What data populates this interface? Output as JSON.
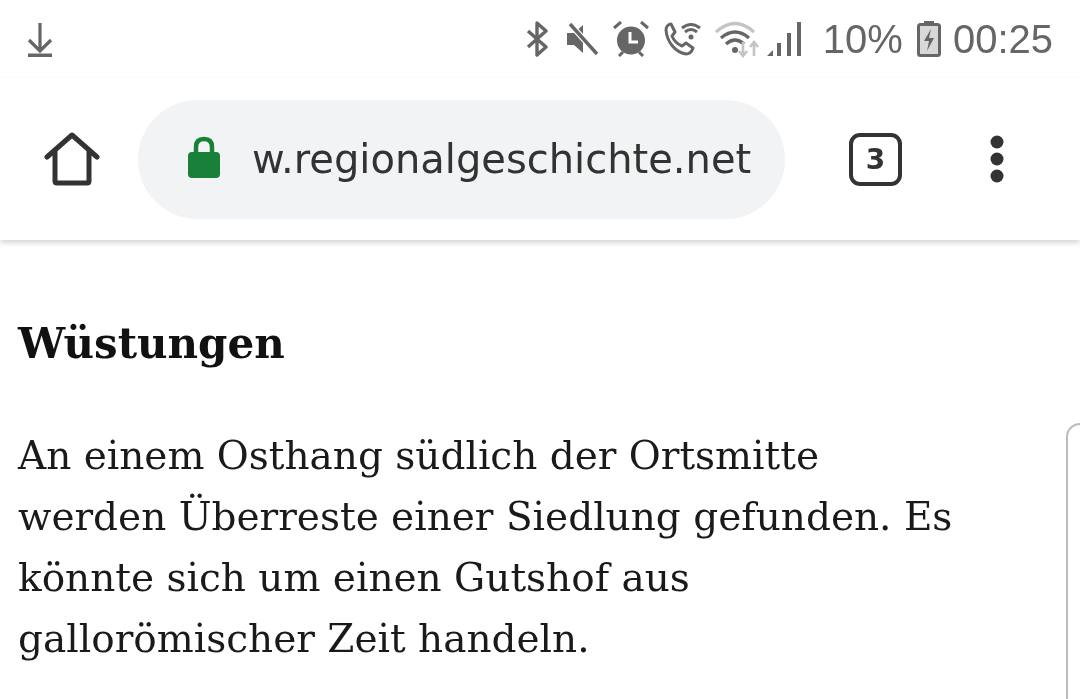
{
  "status_bar": {
    "battery": "10%",
    "time": "00:25"
  },
  "toolbar": {
    "url": "w.regionalgeschichte.net",
    "tab_count": "3"
  },
  "article": {
    "heading": "Wüstungen",
    "paragraph": "An einem Osthang südlich der Ortsmitte werden Überreste einer Siedlung gefunden. Es könnte sich um einen Gutshof aus gallorömischer Zeit handeln."
  }
}
